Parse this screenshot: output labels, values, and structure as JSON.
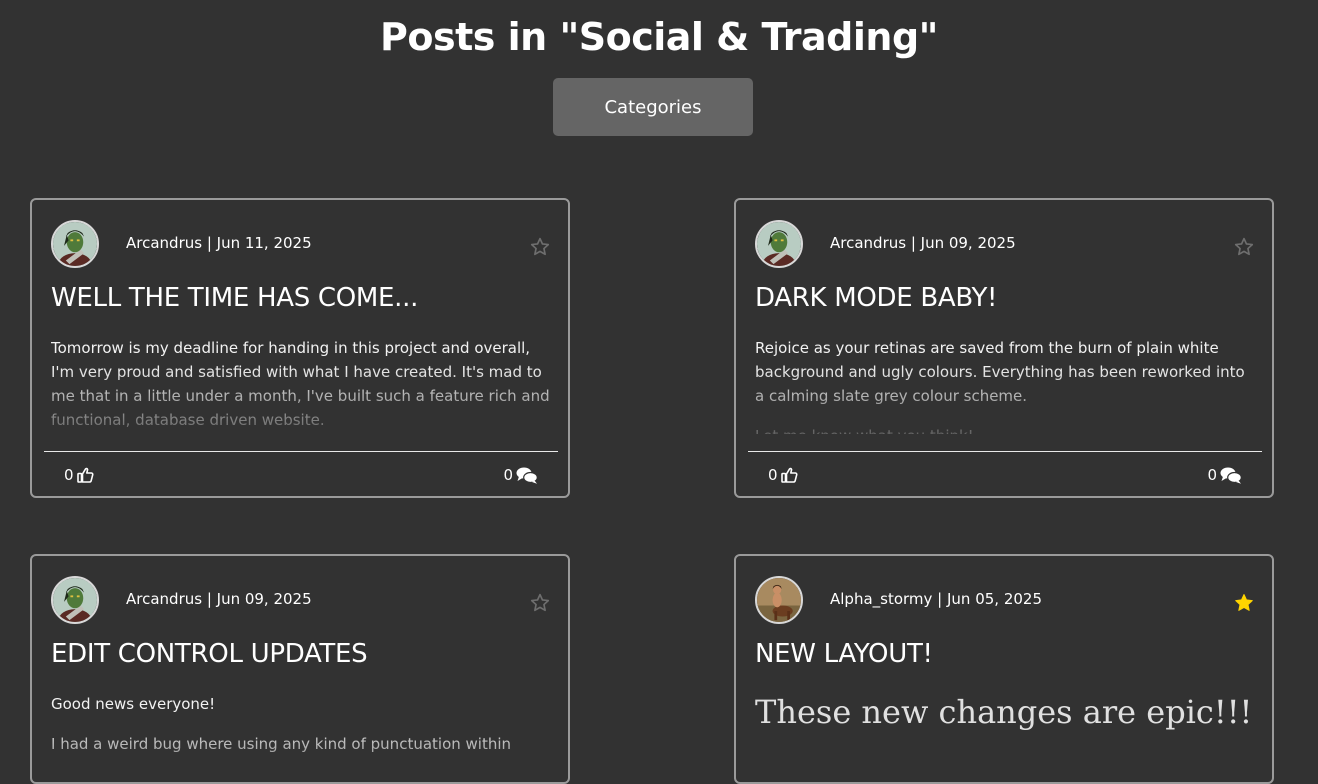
{
  "page": {
    "title": "Posts in \"Social & Trading\"",
    "categories_label": "Categories"
  },
  "colors": {
    "background": "#323232",
    "button": "#656565",
    "card_border": "#9a9a9a",
    "star_empty": "#6e6e6e",
    "star_filled": "#ffd400"
  },
  "posts": [
    {
      "author": "Arcandrus",
      "date": "Jun 11, 2025",
      "byline": "Arcandrus | Jun 11, 2025",
      "title": "WELL THE TIME HAS COME...",
      "excerpt": [
        "Tomorrow is my deadline for handing in this project and overall, I'm very proud and satisfied with what I have created. It's mad to me that in a little under a month, I've built such a feature rich and functional, database driven website."
      ],
      "likes": "0",
      "comments": "0",
      "favorited": false,
      "avatar_icon": "orc-avatar"
    },
    {
      "author": "Arcandrus",
      "date": "Jun 09, 2025",
      "byline": "Arcandrus | Jun 09, 2025",
      "title": "DARK MODE BABY!",
      "excerpt": [
        "Rejoice as your retinas are saved from the burn of plain white background and ugly colours. Everything has been reworked into a calming slate grey colour scheme.",
        "Let me know what you think!"
      ],
      "likes": "0",
      "comments": "0",
      "favorited": false,
      "avatar_icon": "orc-avatar"
    },
    {
      "author": "Arcandrus",
      "date": "Jun 09, 2025",
      "byline": "Arcandrus | Jun 09, 2025",
      "title": "EDIT CONTROL UPDATES",
      "excerpt": [
        "Good news everyone!",
        "I had a weird bug where using any kind of punctuation within"
      ],
      "favorited": false,
      "avatar_icon": "orc-avatar"
    },
    {
      "author": "Alpha_stormy",
      "date": "Jun 05, 2025",
      "byline": "Alpha_stormy | Jun 05, 2025",
      "title": "NEW LAYOUT!",
      "excerpt": [
        "These new changes are epic!!!"
      ],
      "favorited": true,
      "avatar_icon": "centaur-avatar"
    }
  ]
}
